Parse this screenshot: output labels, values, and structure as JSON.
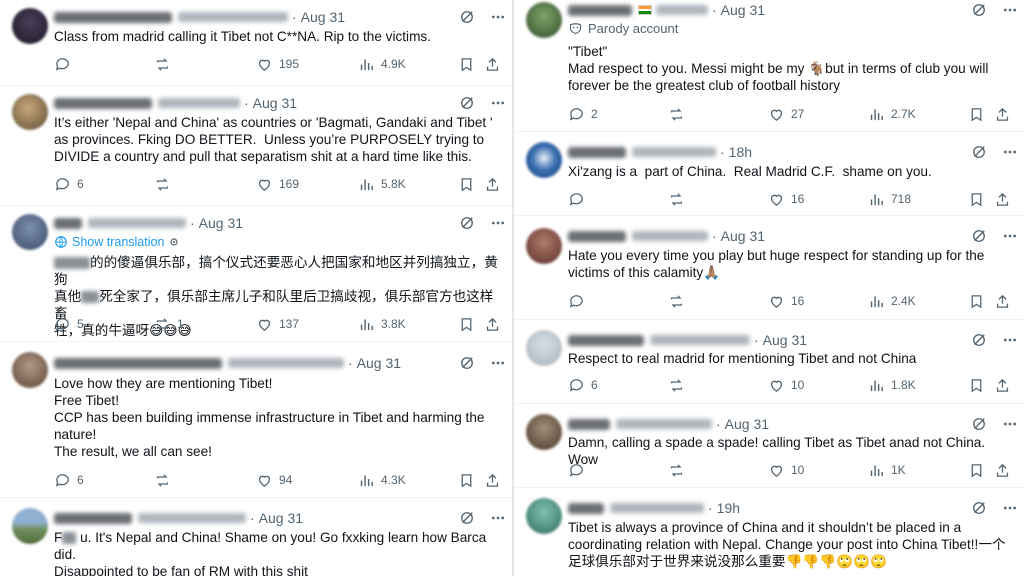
{
  "left_tweets": [
    {
      "date": "Aug 31",
      "text": "Class from madrid calling it Tibet not C**NA. Rip to the victims.",
      "replies": "",
      "reposts": "",
      "likes": "195",
      "views": "4.9K"
    },
    {
      "date": "Aug 31",
      "text": "It’s either 'Nepal and China' as countries or 'Bagmati, Gandaki and Tibet ' as provinces. Fking DO BETTER.  Unless you’re PURPOSELY trying to DIVIDE a country and pull that separatism shit at a hard time like this.",
      "replies": "6",
      "reposts": "",
      "likes": "169",
      "views": "5.8K"
    },
    {
      "date": "Aug 31",
      "translation_label": "Show translation",
      "text_pre": "",
      "text_a": "的的傻逼俱乐部，搞个仪式还要恶心人把国家和地区并列搞独立，黄狗",
      "text_b": "真他",
      "text_c": "死全家了，俱乐部主席儿子和队里后卫搞歧视，俱乐部官方也这样畜",
      "text_d": "牲，真的牛逼呀😅😅😅",
      "replies": "5",
      "reposts": "1",
      "likes": "137",
      "views": "3.8K"
    },
    {
      "date": "Aug 31",
      "text": "Love how they are mentioning Tibet!\nFree Tibet!\nCCP has been building immense infrastructure in Tibet and harming the nature!\nThe result, we all can see!",
      "replies": "6",
      "reposts": "",
      "likes": "94",
      "views": "4.3K"
    },
    {
      "date": "Aug 31",
      "text_a": "F",
      "text_b": " u. It's Nepal and China! Shame on you! Go fxxking learn how Barca did.\nDisappointed to be fan of RM with this shit"
    }
  ],
  "right_tweets": [
    {
      "date": "Aug 31",
      "parody_label": "Parody account",
      "text": "\"Tibet\"\nMad respect to you. Messi might be my 🐐but in terms of club you will forever be the greatest club of football history",
      "replies": "2",
      "reposts": "",
      "likes": "27",
      "views": "2.7K"
    },
    {
      "date": "18h",
      "text": "Xi'zang is a  part of China.  Real Madrid C.F.  shame on you.",
      "replies": "",
      "reposts": "",
      "likes": "16",
      "views": "718"
    },
    {
      "date": "Aug 31",
      "text": "Hate you every time you play but huge respect for standing up for the victims of this calamity🙏🏽",
      "replies": "",
      "reposts": "",
      "likes": "16",
      "views": "2.4K"
    },
    {
      "date": "Aug 31",
      "text": "Respect to real madrid for mentioning Tibet and not China",
      "replies": "6",
      "reposts": "",
      "likes": "10",
      "views": "1.8K"
    },
    {
      "date": "Aug 31",
      "text": "Damn, calling a spade a spade! calling Tibet as Tibet anad not China. Wow",
      "replies": "",
      "reposts": "",
      "likes": "10",
      "views": "1K"
    },
    {
      "date": "19h",
      "text": "Tibet is always a province of China and it shouldn’t be placed in a coordinating relation with Nepal. Change your post into China Tibet!!一个足球俱乐部对于世界来说没那么重要👎👎👎🙄🙄🙄"
    }
  ],
  "icons": {
    "reply": "reply-icon",
    "repost": "repost-icon",
    "like": "like-icon",
    "views": "views-icon",
    "bookmark": "bookmark-icon",
    "share": "share-icon",
    "grok": "grok-icon",
    "more": "more-icon"
  },
  "colors": {
    "muted": "#536471",
    "link": "#1d9bf0",
    "text": "#0f1419"
  }
}
